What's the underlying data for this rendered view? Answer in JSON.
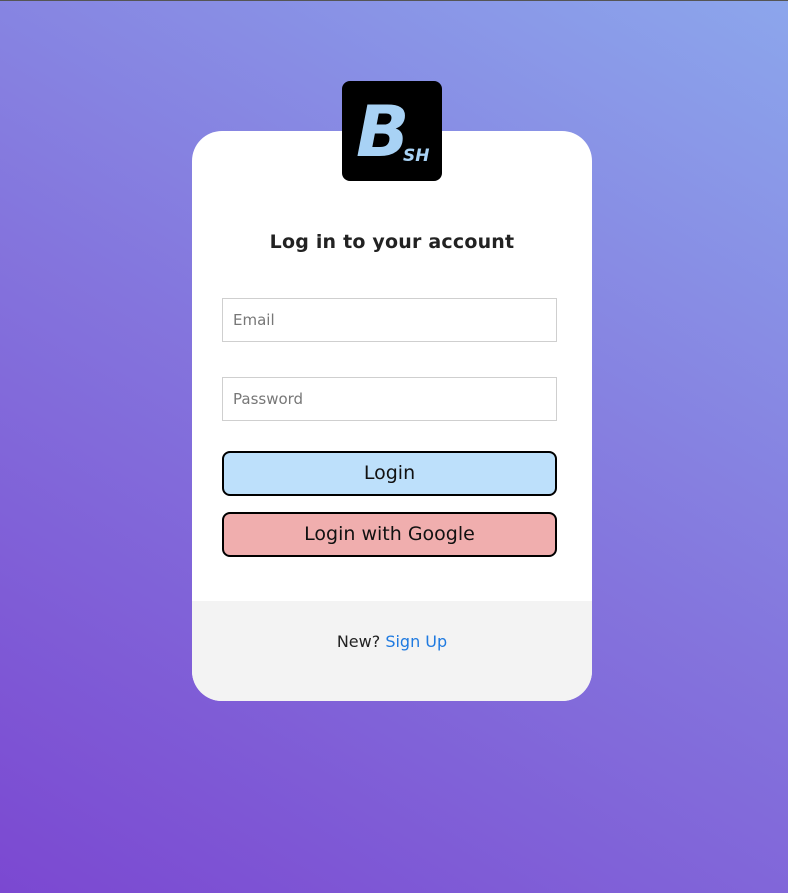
{
  "logo": {
    "letter": "B",
    "subtext": "SH",
    "icon": "bsh-logo"
  },
  "login_form": {
    "title": "Log in to your account",
    "email_placeholder": "Email",
    "password_placeholder": "Password",
    "login_button": "Login",
    "google_button": "Login with Google"
  },
  "footer": {
    "new_text": "New?",
    "signup_link": "Sign Up"
  },
  "colors": {
    "login_button_bg": "#bde0fb",
    "google_button_bg": "#f0aeae",
    "link": "#1f7ae0",
    "logo_letter": "#a8d2f5"
  }
}
